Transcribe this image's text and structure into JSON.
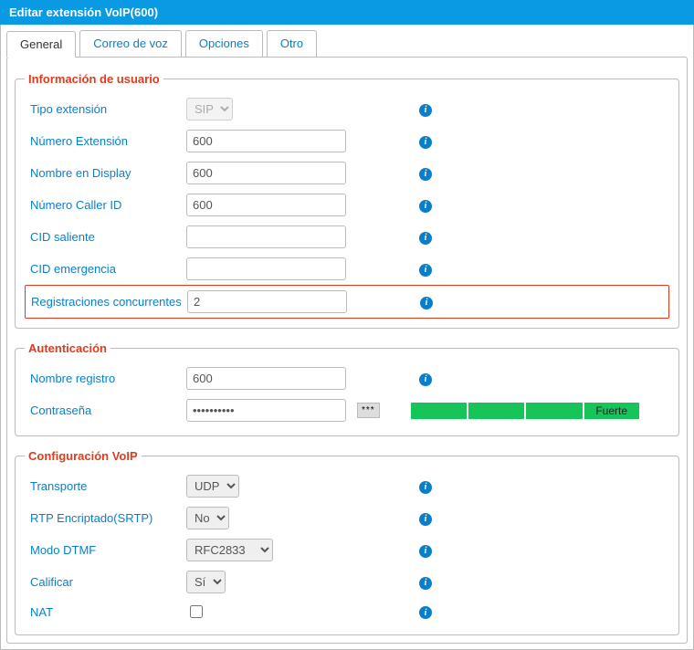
{
  "window_title": "Editar extensión VoIP(600)",
  "tabs": {
    "general": "General",
    "voicemail": "Correo de voz",
    "options": "Opciones",
    "other": "Otro"
  },
  "sections": {
    "user_info": {
      "legend": "Información de usuario",
      "ext_type_label": "Tipo extensión",
      "ext_type_value": "SIP",
      "ext_number_label": "Número Extensión",
      "ext_number_value": "600",
      "display_name_label": "Nombre en Display",
      "display_name_value": "600",
      "caller_id_label": "Número Caller ID",
      "caller_id_value": "600",
      "outbound_cid_label": "CID saliente",
      "outbound_cid_value": "",
      "emergency_cid_label": "CID emergencia",
      "emergency_cid_value": "",
      "concurrent_reg_label": "Registraciones concurrentes",
      "concurrent_reg_value": "2"
    },
    "auth": {
      "legend": "Autenticación",
      "register_name_label": "Nombre registro",
      "register_name_value": "600",
      "password_label": "Contraseña",
      "password_value": "••••••••••",
      "reveal_btn": "***",
      "strength_text": "Fuerte"
    },
    "voip": {
      "legend": "Configuración VoIP",
      "transport_label": "Transporte",
      "transport_value": "UDP",
      "srtp_label": "RTP Encriptado(SRTP)",
      "srtp_value": "No",
      "dtmf_label": "Modo DTMF",
      "dtmf_value": "RFC2833",
      "qualify_label": "Calificar",
      "qualify_value": "Sí",
      "nat_label": "NAT",
      "nat_checked": false
    }
  }
}
